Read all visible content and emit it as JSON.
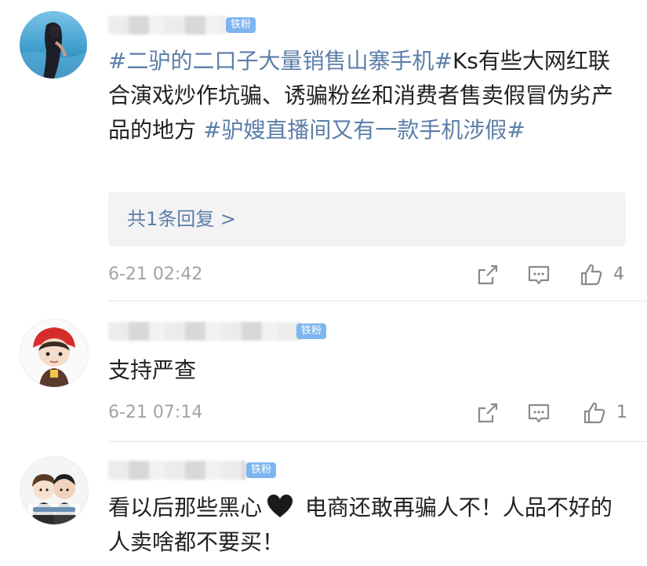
{
  "comments": [
    {
      "badge": "铁粉",
      "text_hashtag1": "#二驴的二口子大量销售山寨手机#",
      "text_body": "Ks有些大网红联合演戏炒作坑骗、诱骗粉丝和消费者售卖假冒伪劣产品的地方 ",
      "text_hashtag2": "#驴嫂直播间又有一款手机涉假#",
      "reply_link": "共1条回复 >",
      "timestamp": "6-21 02:42",
      "like_count": "4"
    },
    {
      "badge": "铁粉",
      "text": "支持严查",
      "timestamp": "6-21 07:14",
      "like_count": "1"
    },
    {
      "badge": "铁粉",
      "text_before": "看以后那些黑心",
      "text_after": " 电商还敢再骗人不！人品不好的人卖啥都不要买！"
    }
  ],
  "icons": {
    "share": "share-icon",
    "comment": "comment-icon",
    "like": "thumbs-up-icon",
    "heart": "black-heart-icon"
  },
  "colors": {
    "hashtag": "#5b7ea8",
    "badge": "#7eb4ef",
    "meta": "#a3a3a3",
    "reply_bg": "#f3f3f3"
  }
}
